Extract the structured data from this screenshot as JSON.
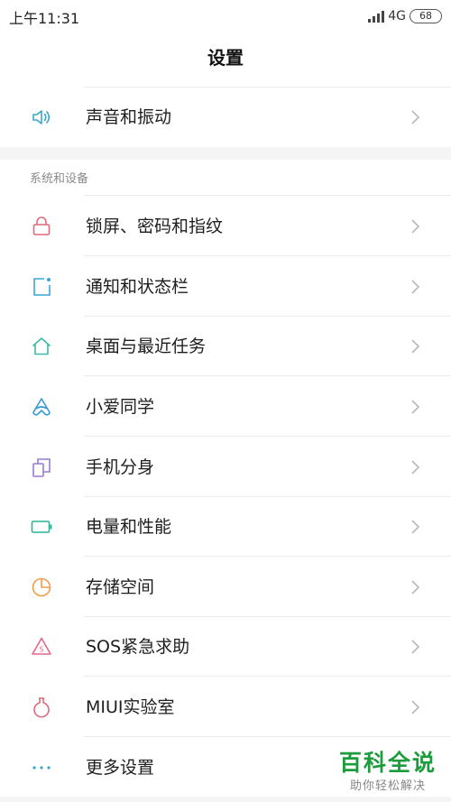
{
  "status_bar": {
    "time": "上午11:31",
    "network": "4G",
    "battery": "68"
  },
  "header": {
    "title": "设置"
  },
  "top_item": {
    "label": "声音和振动",
    "icon": "speaker-icon",
    "color": "#3aa7c9"
  },
  "section": {
    "title": "系统和设备",
    "items": [
      {
        "label": "锁屏、密码和指纹",
        "icon": "lock-icon",
        "color": "#e0697a"
      },
      {
        "label": "通知和状态栏",
        "icon": "notification-icon",
        "color": "#3ba6d8"
      },
      {
        "label": "桌面与最近任务",
        "icon": "home-icon",
        "color": "#3bbba6"
      },
      {
        "label": "小爱同学",
        "icon": "xiaoai-icon",
        "color": "#3a9ad6"
      },
      {
        "label": "手机分身",
        "icon": "dual-phone-icon",
        "color": "#9b7ad6"
      },
      {
        "label": "电量和性能",
        "icon": "battery-icon",
        "color": "#2eb29a"
      },
      {
        "label": "存储空间",
        "icon": "storage-pie-icon",
        "color": "#f29a4a"
      },
      {
        "label": "SOS紧急求助",
        "icon": "sos-icon",
        "color": "#e36a8a"
      },
      {
        "label": "MIUI实验室",
        "icon": "lab-flask-icon",
        "color": "#e36a7a"
      },
      {
        "label": "更多设置",
        "icon": "more-dots-icon",
        "color": "#3aa7c9"
      }
    ]
  },
  "watermark": {
    "title": "百科全说",
    "subtitle": "助你轻松解决"
  }
}
